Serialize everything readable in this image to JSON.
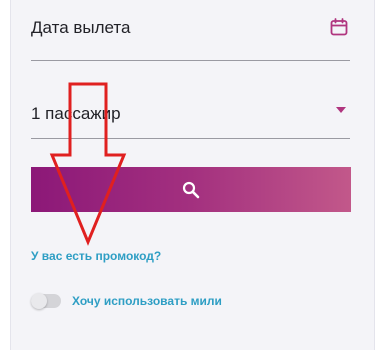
{
  "form": {
    "date_field": {
      "label": "Дата вылета",
      "icon": "calendar-icon"
    },
    "passengers_field": {
      "value": "1 пассажир",
      "icon": "chevron-down-icon"
    },
    "search_button": {
      "icon": "search-icon"
    },
    "promo_link": "У вас есть промокод?",
    "miles_toggle": {
      "label": "Хочу использовать мили",
      "checked": false
    }
  },
  "colors": {
    "accent": "#a3307f",
    "link": "#2e9ec4",
    "annotation": "#e02020"
  }
}
